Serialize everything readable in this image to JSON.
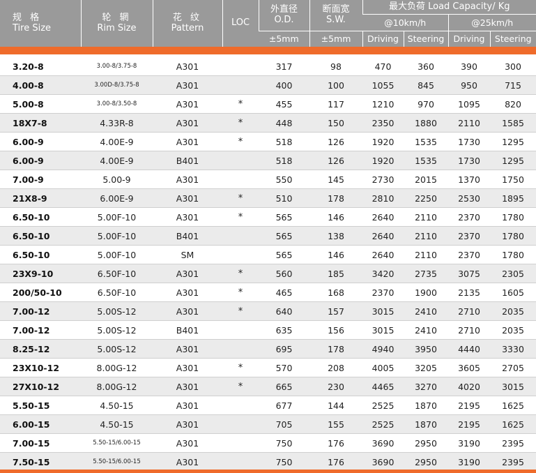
{
  "headers": {
    "tire_size_zh": "规 格",
    "tire_size_en": "Tire Size",
    "rim_size_zh": "轮 辋",
    "rim_size_en": "Rim Size",
    "pattern_zh": "花 纹",
    "pattern_en": "Pattern",
    "loc": "LOC",
    "od_zh": "外直径",
    "od_en": "O.D.",
    "od_tol": "±5mm",
    "sw_zh": "断面宽",
    "sw_en": "S.W.",
    "sw_tol": "±5mm",
    "load_capacity": "最大负荷 Load Capacity/  Kg",
    "speed_10": "@10km/h",
    "speed_25": "@25km/h",
    "driving": "Driving",
    "steering": "Steering"
  },
  "colors": {
    "header_bg": "#9a9a9a",
    "accent_orange": "#ef6b2b",
    "row_alt": "#ebebeb"
  },
  "rows": [
    {
      "size": "3.20-8",
      "rim": "3.00-8/3.75-8",
      "pattern": "A301",
      "loc": "",
      "od": "317",
      "sw": "98",
      "d10": "470",
      "s10": "360",
      "d25": "390",
      "s25": "300"
    },
    {
      "size": "4.00-8",
      "rim": "3.00D-8/3.75-8",
      "pattern": "A301",
      "loc": "",
      "od": "400",
      "sw": "100",
      "d10": "1055",
      "s10": "845",
      "d25": "950",
      "s25": "715"
    },
    {
      "size": "5.00-8",
      "rim": "3.00-8/3.50-8",
      "pattern": "A301",
      "loc": "*",
      "od": "455",
      "sw": "117",
      "d10": "1210",
      "s10": "970",
      "d25": "1095",
      "s25": "820"
    },
    {
      "size": "18X7-8",
      "rim": "4.33R-8",
      "pattern": "A301",
      "loc": "*",
      "od": "448",
      "sw": "150",
      "d10": "2350",
      "s10": "1880",
      "d25": "2110",
      "s25": "1585"
    },
    {
      "size": "6.00-9",
      "rim": "4.00E-9",
      "pattern": "A301",
      "loc": "*",
      "od": "518",
      "sw": "126",
      "d10": "1920",
      "s10": "1535",
      "d25": "1730",
      "s25": "1295"
    },
    {
      "size": "6.00-9",
      "rim": "4.00E-9",
      "pattern": "B401",
      "loc": "",
      "od": "518",
      "sw": "126",
      "d10": "1920",
      "s10": "1535",
      "d25": "1730",
      "s25": "1295"
    },
    {
      "size": "7.00-9",
      "rim": "5.00-9",
      "pattern": "A301",
      "loc": "",
      "od": "550",
      "sw": "145",
      "d10": "2730",
      "s10": "2015",
      "d25": "1370",
      "s25": "1750"
    },
    {
      "size": "21X8-9",
      "rim": "6.00E-9",
      "pattern": "A301",
      "loc": "*",
      "od": "510",
      "sw": "178",
      "d10": "2810",
      "s10": "2250",
      "d25": "2530",
      "s25": "1895"
    },
    {
      "size": "6.50-10",
      "rim": "5.00F-10",
      "pattern": "A301",
      "loc": "*",
      "od": "565",
      "sw": "146",
      "d10": "2640",
      "s10": "2110",
      "d25": "2370",
      "s25": "1780"
    },
    {
      "size": "6.50-10",
      "rim": "5.00F-10",
      "pattern": "B401",
      "loc": "",
      "od": "565",
      "sw": "138",
      "d10": "2640",
      "s10": "2110",
      "d25": "2370",
      "s25": "1780"
    },
    {
      "size": "6.50-10",
      "rim": "5.00F-10",
      "pattern": "SM",
      "loc": "",
      "od": "565",
      "sw": "146",
      "d10": "2640",
      "s10": "2110",
      "d25": "2370",
      "s25": "1780"
    },
    {
      "size": "23X9-10",
      "rim": "6.50F-10",
      "pattern": "A301",
      "loc": "*",
      "od": "560",
      "sw": "185",
      "d10": "3420",
      "s10": "2735",
      "d25": "3075",
      "s25": "2305"
    },
    {
      "size": "200/50-10",
      "rim": "6.50F-10",
      "pattern": "A301",
      "loc": "*",
      "od": "465",
      "sw": "168",
      "d10": "2370",
      "s10": "1900",
      "d25": "2135",
      "s25": "1605"
    },
    {
      "size": "7.00-12",
      "rim": "5.00S-12",
      "pattern": "A301",
      "loc": "*",
      "od": "640",
      "sw": "157",
      "d10": "3015",
      "s10": "2410",
      "d25": "2710",
      "s25": "2035"
    },
    {
      "size": "7.00-12",
      "rim": "5.00S-12",
      "pattern": "B401",
      "loc": "",
      "od": "635",
      "sw": "156",
      "d10": "3015",
      "s10": "2410",
      "d25": "2710",
      "s25": "2035"
    },
    {
      "size": "8.25-12",
      "rim": "5.00S-12",
      "pattern": "A301",
      "loc": "",
      "od": "695",
      "sw": "178",
      "d10": "4940",
      "s10": "3950",
      "d25": "4440",
      "s25": "3330"
    },
    {
      "size": "23X10-12",
      "rim": "8.00G-12",
      "pattern": "A301",
      "loc": "*",
      "od": "570",
      "sw": "208",
      "d10": "4005",
      "s10": "3205",
      "d25": "3605",
      "s25": "2705"
    },
    {
      "size": "27X10-12",
      "rim": "8.00G-12",
      "pattern": "A301",
      "loc": "*",
      "od": "665",
      "sw": "230",
      "d10": "4465",
      "s10": "3270",
      "d25": "4020",
      "s25": "3015"
    },
    {
      "size": "5.50-15",
      "rim": "4.50-15",
      "pattern": "A301",
      "loc": "",
      "od": "677",
      "sw": "144",
      "d10": "2525",
      "s10": "1870",
      "d25": "2195",
      "s25": "1625"
    },
    {
      "size": "6.00-15",
      "rim": "4.50-15",
      "pattern": "A301",
      "loc": "",
      "od": "705",
      "sw": "155",
      "d10": "2525",
      "s10": "1870",
      "d25": "2195",
      "s25": "1625"
    },
    {
      "size": "7.00-15",
      "rim": "5.50-15/6.00-15",
      "pattern": "A301",
      "loc": "",
      "od": "750",
      "sw": "176",
      "d10": "3690",
      "s10": "2950",
      "d25": "3190",
      "s25": "2395"
    },
    {
      "size": "7.50-15",
      "rim": "5.50-15/6.00-15",
      "pattern": "A301",
      "loc": "",
      "od": "750",
      "sw": "176",
      "d10": "3690",
      "s10": "2950",
      "d25": "3190",
      "s25": "2395"
    }
  ]
}
